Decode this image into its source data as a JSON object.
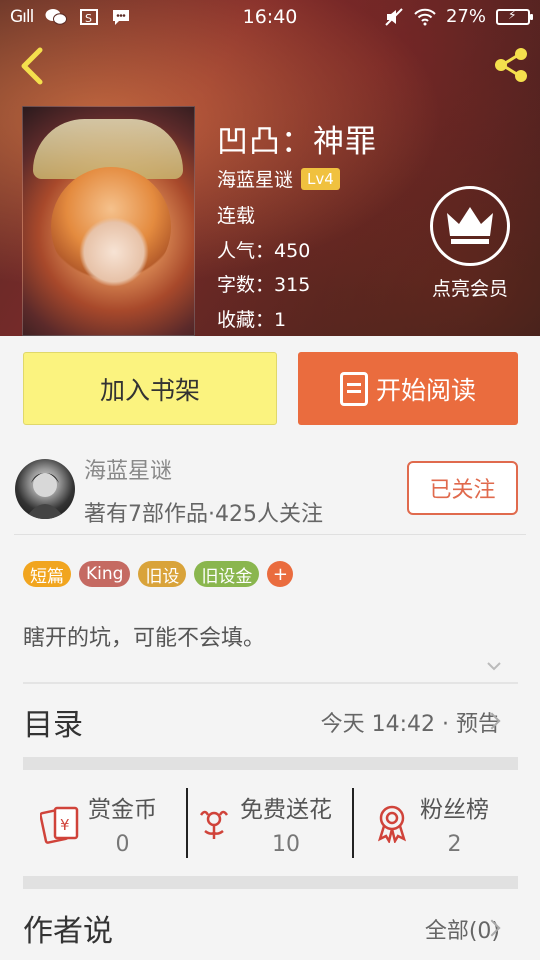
{
  "status": {
    "time": "16:40",
    "signal": "Gıll",
    "battery": "27%"
  },
  "book": {
    "title": "凹凸：神罪",
    "author": "海蓝星谜",
    "level": "Lv4",
    "state": "连载",
    "popularity_label": "人气：",
    "popularity": "450",
    "words_label": "字数：",
    "words": "315",
    "favorites_label": "收藏：",
    "favorites": "1"
  },
  "vip": {
    "label": "点亮会员"
  },
  "buttons": {
    "shelf": "加入书架",
    "read": "开始阅读"
  },
  "author": {
    "name": "海蓝星谜",
    "stats": "著有7部作品·425人关注",
    "follow": "已关注"
  },
  "tags": [
    {
      "label": "短篇",
      "color": "#f1a51f"
    },
    {
      "label": "King",
      "color": "#c56a62"
    },
    {
      "label": "旧设",
      "color": "#d9a33a"
    },
    {
      "label": "旧设金",
      "color": "#8ab64e"
    },
    {
      "label": "+",
      "color": "#ea6c3e"
    }
  ],
  "description": "瞎开的坑，可能不会填。",
  "toc": {
    "title": "目录",
    "info": "今天 14:42 · 预告"
  },
  "stats": [
    {
      "label": "赏金币",
      "value": "0",
      "icon": "red-envelope-icon"
    },
    {
      "label": "免费送花",
      "value": "10",
      "icon": "flower-icon"
    },
    {
      "label": "粉丝榜",
      "value": "2",
      "icon": "ribbon-badge-icon"
    }
  ],
  "author_say": {
    "title": "作者说",
    "info": "全部(0)"
  }
}
